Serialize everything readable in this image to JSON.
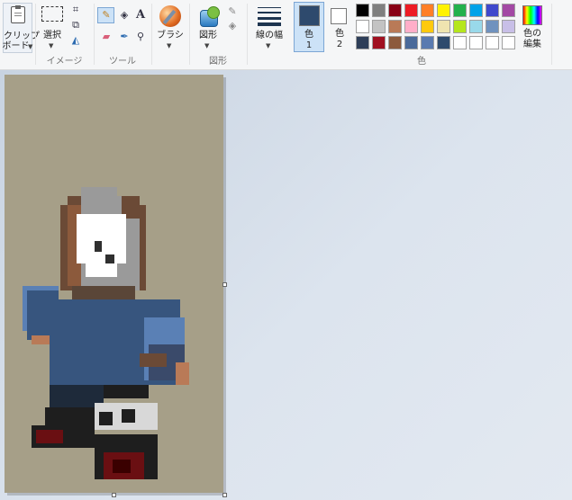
{
  "ribbon": {
    "clipboard": {
      "label_line1": "クリップ",
      "label_line2": "ボード"
    },
    "image": {
      "group_label": "イメージ",
      "select_label": "選択"
    },
    "tools": {
      "group_label": "ツール"
    },
    "brushes": {
      "label": "ブラシ"
    },
    "shapes": {
      "group_label": "図形",
      "label": "図形"
    },
    "size": {
      "label": "線の幅"
    },
    "color1": {
      "label_line1": "色",
      "label_line2": "1",
      "value": "#2e4a6d"
    },
    "color2": {
      "label_line1": "色",
      "label_line2": "2",
      "value": "#ffffff"
    },
    "colors": {
      "group_label": "色"
    },
    "edit_colors": {
      "label_line1": "色の",
      "label_line2": "編集"
    }
  },
  "palette": [
    "#000000",
    "#7f7f7f",
    "#880015",
    "#ed1c24",
    "#ff7f27",
    "#fff200",
    "#22b14c",
    "#00a2e8",
    "#3f48cc",
    "#a349a4",
    "#ffffff",
    "#c3c3c3",
    "#b97a57",
    "#ffaec9",
    "#ffc90e",
    "#efe4b0",
    "#b5e61d",
    "#99d9ea",
    "#7092be",
    "#c8bfe7",
    "#2e3e58",
    "#a01020",
    "#8c5a3c",
    "#4a6a9a",
    "#5a7ab0",
    "#2e4a6d",
    "#ffffff",
    "#ffffff",
    "#ffffff",
    "#ffffff"
  ],
  "canvas_colors": {
    "background": "#a69f88",
    "suit": "#37557e",
    "suit_light": "#5a80b5",
    "hair": "#6b4a36",
    "hair_light": "#8c5a3c",
    "gray": "#9a9a9a",
    "mask": "#ffffff",
    "tie": "#c0151c",
    "shoe": "#1e1e1e",
    "blood": "#6a0f12",
    "skin": "#b97a57"
  }
}
